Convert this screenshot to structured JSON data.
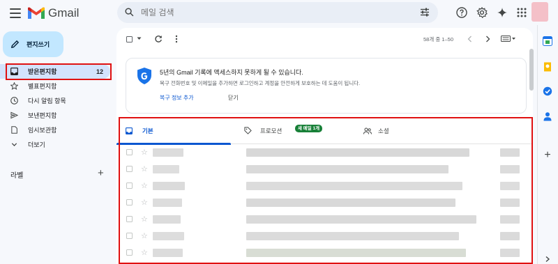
{
  "app": {
    "name": "Gmail"
  },
  "search": {
    "placeholder": "메일 검색"
  },
  "compose": {
    "label": "편지쓰기"
  },
  "nav": {
    "items": [
      {
        "label": "받은편지함",
        "count": "12",
        "icon": "inbox-icon"
      },
      {
        "label": "별표편지함",
        "count": "",
        "icon": "star-icon"
      },
      {
        "label": "다시 알림 항목",
        "count": "",
        "icon": "clock-icon"
      },
      {
        "label": "보낸편지함",
        "count": "",
        "icon": "send-icon"
      },
      {
        "label": "임시보관함",
        "count": "",
        "icon": "draft-icon"
      },
      {
        "label": "더보기",
        "count": "",
        "icon": "chevron-down-icon"
      }
    ]
  },
  "labels": {
    "title": "라벨",
    "add": "+"
  },
  "toolbar": {
    "pager": "58개 중 1–50"
  },
  "banner": {
    "title": "5년의 Gmail 기록에 액세스하지 못하게 될 수 있습니다.",
    "description": "복구 전화번호 및 이메일을 추가하면 로그인하고 계정을 안전하게 보호하는 데 도움이 됩니다.",
    "action_primary": "복구 정보 추가",
    "action_dismiss": "닫기"
  },
  "tabs": [
    {
      "label": "기본",
      "badge": ""
    },
    {
      "label": "프로모션",
      "badge": "새 메일 1개"
    },
    {
      "label": "소셜",
      "badge": ""
    }
  ],
  "colors": {
    "accent": "#0b57d0",
    "compose_bg": "#c2e7ff",
    "active_nav": "#d3e3fd",
    "highlight": "#e01010",
    "badge_green": "#188038"
  }
}
